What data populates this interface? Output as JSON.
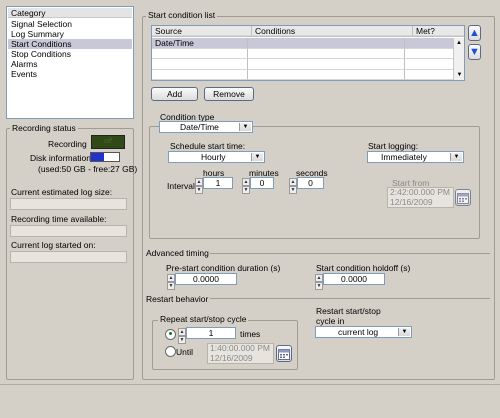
{
  "category": {
    "header": "Category",
    "items": [
      "Signal Selection",
      "Log Summary",
      "Start Conditions",
      "Stop Conditions",
      "Alarms",
      "Events"
    ],
    "selected": "Start Conditions"
  },
  "recording_status": {
    "title": "Recording status",
    "recording_label": "Recording",
    "indicator_text": "off",
    "disk_label": "Disk information",
    "disk_used_fraction": 0.46,
    "disk_text": "(used:50 GB - free:27 GB)",
    "log_size_label": "Current estimated log size:",
    "log_size_value": "",
    "time_avail_label": "Recording time available:",
    "time_avail_value": "",
    "log_started_label": "Current log started on:",
    "log_started_value": ""
  },
  "start_list": {
    "title": "Start condition list",
    "columns": [
      "Source",
      "Conditions",
      "Met?"
    ],
    "rows": [
      [
        "Date/Time",
        "",
        ""
      ],
      [
        "",
        "",
        ""
      ],
      [
        "",
        "",
        ""
      ],
      [
        "",
        "",
        ""
      ]
    ],
    "add_label": "Add",
    "remove_label": "Remove",
    "up_icon": "▲",
    "down_icon": "▼"
  },
  "condition": {
    "type_label": "Condition type",
    "type_value": "Date/Time",
    "schedule_label": "Schedule start time:",
    "schedule_value": "Hourly",
    "hours_label": "hours",
    "minutes_label": "minutes",
    "seconds_label": "seconds",
    "interval_label": "Interval:",
    "hours_value": "1",
    "minutes_value": "0",
    "seconds_value": "0",
    "start_logging_label": "Start logging:",
    "start_logging_value": "Immediately",
    "start_from_label": "Start from",
    "start_from_time": "2:42:00.000 PM",
    "start_from_date": "12/16/2009"
  },
  "advanced": {
    "title": "Advanced timing",
    "pre_label": "Pre-start condition duration (s)",
    "pre_value": "0.0000",
    "holdoff_label": "Start condition holdoff (s)",
    "holdoff_value": "0.0000"
  },
  "restart": {
    "title": "Restart behavior",
    "repeat_title": "Repeat start/stop cycle",
    "times_value": "1",
    "times_label": "times",
    "until_label": "Until",
    "until_time": "1:40:00.000 PM",
    "until_date": "12/16/2009",
    "cycle_label_1": "Restart start/stop",
    "cycle_label_2": "cycle in",
    "cycle_value": "current log"
  },
  "colors": {
    "indicator": "#2f4a16",
    "disk_fill": "#2233cc",
    "arrow_blue": "#1f4fd6"
  }
}
